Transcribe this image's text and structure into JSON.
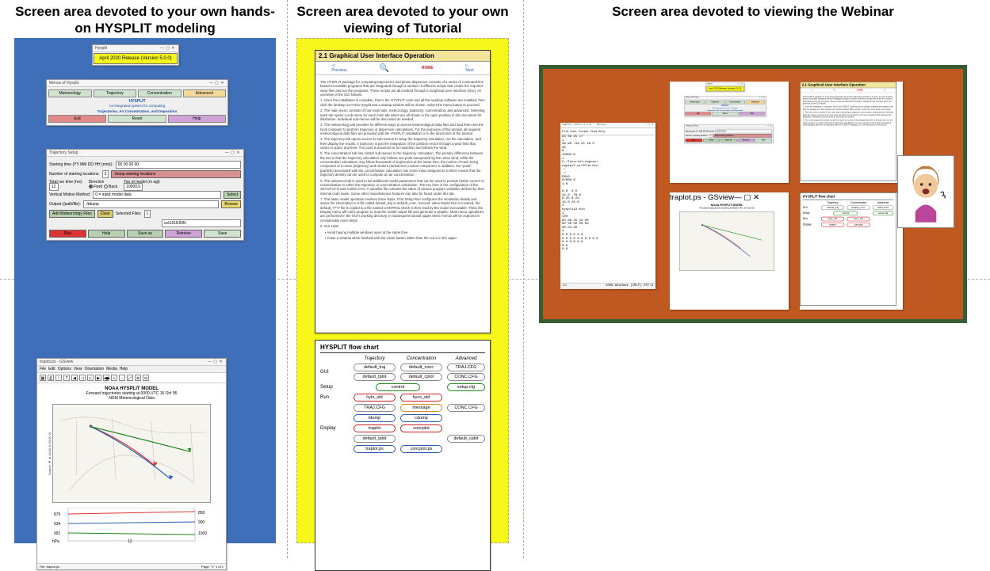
{
  "titles": {
    "hands_on": "Screen area devoted to your own hands-on HYSPLIT modeling",
    "tutorial": "Screen area devoted to your own viewing of Tutorial",
    "webinar": "Screen area devoted to viewing the Webinar"
  },
  "version_win": {
    "title": "Hysplit",
    "body": "April 2020 Release (Version 5.0.0)"
  },
  "menus_win": {
    "title": "Menus of Hysplit",
    "row1": [
      "Meteorology",
      "Trajectory",
      "Concentration",
      "Advanced"
    ],
    "hys_title": "HYSPLIT",
    "hys_sub1": "An integrated system for computing",
    "hys_sub2": "Trajectories, Air Concentration, and Deposition",
    "row2": [
      "Exit",
      "Reset",
      "Help"
    ]
  },
  "setup_win": {
    "title": "Trajectory Setup",
    "start_label": "Starting time (YY MM DD HH {mm}):",
    "start_val": "00 00 00 00",
    "nloc_label": "Number of starting locations:",
    "nloc_val": "3",
    "setup_loc_btn": "Setup starting locations",
    "runtime_label": "Total run time (hrs)",
    "runtime_val": "12",
    "dir_label": "Direction",
    "dir_fwd": "Fwrd",
    "dir_back": "Back",
    "top_label": "Top of model (m agl)",
    "top_val": "10000.0",
    "vmm_label": "Vertical Motion Method:",
    "vmm_val": "0 = input model data",
    "vmm_btn": "Select",
    "output_label": "Output (/path/file):",
    "output_val": "./tdump",
    "output_btn": "Browse",
    "meteo_btn": "Add Meteorology Files",
    "clear_btn": "Clear",
    "sel_label": "Selected Files:",
    "sel_val": "1",
    "file": "oct1618.BIN",
    "bottom": [
      "Run",
      "Help",
      "Save as",
      "Retrieve",
      "Save"
    ]
  },
  "gsview": {
    "title": "traplot.ps - GSview",
    "menu": [
      "File",
      "Edit",
      "Options",
      "View",
      "Orientation",
      "Media",
      "Help"
    ],
    "chart_title": "NOAA HYSPLIT MODEL",
    "chart_sub1": "Forward trajectories starting at 0000 UTC 16 Oct 95",
    "chart_sub2": "NGM  Meteorological Data",
    "ylab": "Source ★ at  40.00 N   90.00 W",
    "levels": [
      "879",
      "934",
      "991"
    ],
    "level_right": [
      "850",
      "900",
      "1000"
    ],
    "hpa": "hPa",
    "xticks": "12",
    "status_l": "File: traplot.ps",
    "status_r": "Page: \"1\" 1 of 1"
  },
  "tutorial": {
    "heading": "2.1 Graphical User Interface Operation",
    "nav": {
      "prev": "Previous",
      "home": "HOME",
      "next": "Next"
    },
    "p0": "The HYSPLIT package for computing trajectories and plume dispersion consists of a series of command-line based executable programs that are integrated through a number of different scripts that create the required input files and run the programs. These scripts are all invoked through a Graphical User Interface (GUI). An overview of the GUI follows.",
    "li1": "Once the installation is complete, that is the HYSPLIT code and all the auxiliary software are installed, then click the desktop icon Run Hysplit and a startup window will be shown. Select the menu button to proceed.",
    "li2": "The main menu consists of four main tabs, meteorology, trajectory, concentration, and advanced. Selecting each tab opens a sub-menu for each main tab which are all shown in the open position in this document for illustration. Individual sub-menus will be discussed as needed.",
    "li3": "The meteorology tab provides for different ways to access meteorological data files and load them into the local computer to perform trajectory or dispersion calculations. For the purposes of this tutorial, all required meteorological data files are provided with the HYSPLIT installation or in the directories of the tutorial.",
    "li4": "The trajectory tab opens access to sub-menus to setup the trajectory simulation, run the calculation, and then display the results. A trajectory is just the integration of the position vector through a wind field that varies in space and time. The point is assumed to be massless and follows the wind.",
    "li5": "The concentration tab has similar sub-menus to the trajectory calculation. The primary difference between the two is that the trajectory calculation only follows one point transported by the mean wind, while the concentration calculation may follow thousands of trajectories at the same time, the motion of each being composed of a mean (trajectory) and random (turbulence) motion component. In addition, the \"point\" (particle) associated with the concentration calculation has some mass assigned to it which means that the trajectory density can be used to compute an air concentration.",
    "li6": "The advanced tab is used to set additional model parameters that can be used to provide further control or customization to either the trajectory or concentration calculation. The key here is the configuration of the SETUP.CFG and CONC.CFG. A namelist file contains the value of various program variables defined by their internal code name. Some other miscellaneous features can also be found under this tab.",
    "li7": "The basic model operation involves three steps. First Setup Run configures the simulation details and saves the information to a file called default_traj or default_conc. Second, when Model Run is invoked, the default_???? file is copied to a file named CONTROL which is then read by the model executable. Third, the Display menu will call a program to read the model output file and generate a graphic. Most menu operations are performed in the GUI's working directory. In subsequent tutorial pages these menus will be explored in considerably more detail.",
    "li8_h": "GUI Hints",
    "li8_a": "Avoid having multiple windows open at the same time.",
    "li8_b": "Close a window when finished with the Close button rather than the red X in the upper"
  },
  "flowchart": {
    "title": "HYSPLIT flow chart",
    "cols": [
      "",
      "Trajectory",
      "Concentration",
      "Advanced"
    ],
    "rows": {
      "GUI": [
        [
          "default_traj",
          "default_tplot"
        ],
        [
          "default_conc",
          "default_cplot"
        ],
        [
          "TRAJ.CFG",
          "CONC.CFG"
        ]
      ],
      "Setup": [
        "control",
        "",
        "setup.cfg"
      ],
      "Run": [
        "hyts_std",
        "hycs_std",
        ""
      ],
      "Run2": [
        "TRAJ.CFG",
        "message",
        "CONC.CFG"
      ],
      "Run3": [
        "tdump",
        "cdump",
        ""
      ],
      "Display": [
        "traplot",
        "concplot",
        ""
      ],
      "Display2": [
        "default_tplot",
        "",
        "default_cplot"
      ],
      "Display3": [
        "traplot.ps",
        "concplot.ps",
        ""
      ]
    }
  },
  "webinar": {
    "notepad": {
      "title": "captex_control.txt - Notep...",
      "menu": "File  Edit  Format  View  Help",
      "lines": [
        "83 09 25 17",
        "1",
        "39.90 -84.22 10.0",
        "48",
        "0",
        "10000.0",
        "1",
        "C:/Tutorial/captex/",
        "captex2_wrf27uw.bin",
        "./",
        "./",
        "PM10",
        "67000.0",
        "1.0",
        "",
        "0.0  0.0",
        "42.0 -78.0",
        "0.25 0.25",
        "15.0 25.0",
        "1",
        "hysplit2.bin",
        "1",
        "100",
        "83 09 25 18 00",
        "00 00 00 00 00",
        "00 03 00",
        "1",
        "0.0 0.0 0.0",
        "0.0 0.0 0.0 0.0 0.0",
        "0.0 0.0 0.0",
        "0.0",
        "0.0"
      ],
      "status": {
        "l": "Ln",
        "c": "100%   Windows (CRLF)   UTF-8"
      }
    },
    "flow_label": "HYSPLIT flow chart"
  },
  "chart_data": {
    "type": "line-map",
    "title": "NOAA HYSPLIT MODEL — Forward trajectories starting at 0000 UTC 16 Oct 95, NGM Meteorological Data",
    "source": {
      "lat": 40.0,
      "lon": -90.0
    },
    "trajectories": [
      {
        "color": "#d33",
        "start_hpa": 879,
        "end_hpa_approx": 850
      },
      {
        "color": "#2a5fb0",
        "start_hpa": 934,
        "end_hpa_approx": 900
      },
      {
        "color": "#1a8a1a",
        "start_hpa": 991,
        "end_hpa_approx": 1000
      }
    ],
    "pressure_panel": {
      "ylabel": "hPa",
      "left_ticks": [
        879,
        934,
        991
      ],
      "right_ticks": [
        850,
        900,
        1000
      ],
      "x_tick": "12"
    }
  }
}
